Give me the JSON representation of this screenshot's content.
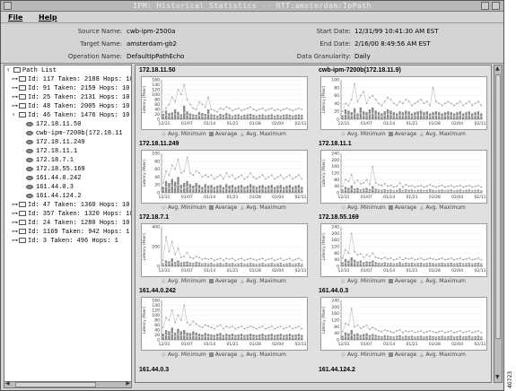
{
  "window": {
    "title": "IPM: Historical Statistics -- RTT:amsterdam:IpPath"
  },
  "menu": {
    "file": "File",
    "help": "Help"
  },
  "info": {
    "source_label": "Source Name:",
    "source_value": "cwb-ipm-2500a",
    "target_label": "Target Name:",
    "target_value": "amsterdam-gb2",
    "operation_label": "Operation Name:",
    "operation_value": "DefaultIpPathEcho",
    "start_label": "Start Date:",
    "start_value": "12/31/99 10:41:30 AM EST",
    "end_label": "End Date:",
    "end_value": "2/16/00 8:49:56 AM EST",
    "gran_label": "Data Granularity:",
    "gran_value": "Daily"
  },
  "tree": {
    "root": "Path List",
    "paths": [
      "Id: 117  Taken: 2188  Hops: 10",
      "Id:  91  Taken: 2159  Hops: 10",
      "Id:  25  Taken: 2131  Hops: 10",
      "Id:  48  Taken: 2005  Hops: 10",
      "Id:  46  Taken: 1476  Hops: 10"
    ],
    "hops": [
      "172.18.11.50",
      "cwb-ipm-7200b(172.18.11",
      "172.18.11.249",
      "172.18.11.1",
      "172.18.7.1",
      "172.18.55.169",
      "161.44.0.242",
      "161.44.0.3",
      "161.44.124.2"
    ],
    "paths_after": [
      "Id:  47  Taken: 1360  Hops: 10",
      "Id: 357  Taken: 1320  Hops: 10",
      "Id:  24  Taken: 1280  Hops: 10",
      "Id: 1169  Taken: 942  Hops: 1",
      "Id:   3  Taken: 496  Hops: 1"
    ]
  },
  "legend": {
    "min": "Avg. Minimum",
    "avg": "Average",
    "max": "Avg. Maximum"
  },
  "ylabel": "Latency (Msec)",
  "xticks": [
    "12/31",
    "01/07",
    "01/14",
    "01/21",
    "01/28",
    "02/04",
    "02/11"
  ],
  "chart_data": [
    {
      "type": "bar",
      "title": "172.18.11.50",
      "yticks": [
        "0",
        "20",
        "40",
        "60",
        "80",
        "100",
        "120",
        "140",
        "160"
      ],
      "ylim": [
        0,
        160
      ],
      "avg": [
        22,
        35,
        25,
        28,
        40,
        30,
        20,
        55,
        32,
        24,
        20,
        18,
        30,
        25,
        22,
        40,
        20,
        18,
        15,
        22,
        18,
        25,
        20,
        15,
        18,
        20,
        15,
        18,
        20,
        22,
        18,
        15,
        18,
        20,
        15,
        18,
        20,
        15,
        18,
        15,
        18,
        20,
        18,
        15,
        18,
        20,
        18
      ],
      "max": [
        30,
        45,
        60,
        90,
        70,
        120,
        100,
        140,
        80,
        60,
        45,
        40,
        70,
        60,
        50,
        90,
        40,
        35,
        30,
        45,
        40,
        50,
        45,
        35,
        40,
        45,
        35,
        40,
        45,
        50,
        40,
        35,
        40,
        45,
        35,
        40,
        45,
        35,
        40,
        35,
        40,
        45,
        40,
        35,
        40,
        45,
        40
      ]
    },
    {
      "type": "bar",
      "title": "cwb-ipm-7200b(172.18.11.9)",
      "yticks": [
        "0",
        "20",
        "40",
        "60",
        "80",
        "100"
      ],
      "ylim": [
        0,
        100
      ],
      "avg": [
        10,
        25,
        22,
        18,
        28,
        15,
        30,
        20,
        18,
        25,
        30,
        22,
        18,
        15,
        20,
        25,
        22,
        18,
        15,
        20,
        18,
        22,
        20,
        15,
        18,
        20,
        22,
        18,
        20,
        15,
        18,
        20,
        18,
        15,
        18,
        20,
        18,
        15,
        18,
        20,
        15,
        18,
        20,
        15,
        18,
        20,
        15
      ],
      "max": [
        20,
        40,
        35,
        50,
        90,
        45,
        60,
        70,
        40,
        55,
        60,
        50,
        40,
        35,
        45,
        55,
        50,
        40,
        35,
        45,
        40,
        50,
        45,
        35,
        40,
        45,
        50,
        40,
        45,
        35,
        80,
        45,
        40,
        35,
        40,
        45,
        40,
        35,
        40,
        45,
        35,
        40,
        45,
        35,
        40,
        45,
        35
      ]
    },
    {
      "type": "bar",
      "title": "172.18.11.249",
      "yticks": [
        "0",
        "20",
        "40",
        "60",
        "80",
        "100"
      ],
      "ylim": [
        0,
        100
      ],
      "avg": [
        15,
        30,
        25,
        35,
        28,
        40,
        20,
        25,
        30,
        22,
        18,
        25,
        20,
        15,
        22,
        18,
        20,
        15,
        18,
        20,
        15,
        22,
        18,
        20,
        15,
        18,
        20,
        15,
        18,
        22,
        18,
        15,
        18,
        20,
        15,
        18,
        20,
        15,
        18,
        20,
        15,
        18,
        20,
        15,
        18,
        20,
        15
      ],
      "max": [
        25,
        55,
        45,
        70,
        60,
        85,
        50,
        55,
        90,
        50,
        45,
        55,
        50,
        40,
        45,
        40,
        45,
        35,
        40,
        45,
        35,
        50,
        40,
        45,
        35,
        40,
        45,
        35,
        40,
        50,
        40,
        35,
        40,
        45,
        35,
        40,
        45,
        35,
        40,
        45,
        35,
        40,
        45,
        35,
        40,
        45,
        35
      ]
    },
    {
      "type": "bar",
      "title": "172.18.11.1",
      "yticks": [
        "0",
        "40",
        "80",
        "120",
        "160",
        "200",
        "240"
      ],
      "ylim": [
        0,
        240
      ],
      "avg": [
        20,
        35,
        30,
        45,
        25,
        30,
        20,
        25,
        30,
        22,
        40,
        25,
        20,
        18,
        22,
        18,
        20,
        15,
        18,
        25,
        15,
        22,
        18,
        20,
        15,
        18,
        20,
        15,
        18,
        22,
        18,
        15,
        18,
        20,
        15,
        18,
        20,
        15,
        18,
        20,
        15,
        18,
        20,
        15,
        18,
        20,
        15
      ],
      "max": [
        40,
        80,
        70,
        110,
        60,
        75,
        55,
        60,
        80,
        50,
        160,
        60,
        50,
        45,
        55,
        40,
        45,
        35,
        40,
        60,
        35,
        50,
        40,
        45,
        35,
        40,
        45,
        35,
        40,
        50,
        40,
        35,
        40,
        45,
        35,
        40,
        45,
        35,
        40,
        45,
        35,
        40,
        45,
        35,
        40,
        45,
        35
      ]
    },
    {
      "type": "bar",
      "title": "172.18.7.1",
      "yticks": [
        "0",
        "200",
        "400"
      ],
      "ylim": [
        0,
        400
      ],
      "avg": [
        30,
        60,
        50,
        80,
        45,
        60,
        40,
        45,
        50,
        40,
        35,
        45,
        40,
        30,
        35,
        30,
        35,
        25,
        30,
        35,
        25,
        35,
        30,
        35,
        25,
        30,
        35,
        25,
        30,
        35,
        30,
        25,
        30,
        35,
        25,
        30,
        35,
        25,
        30,
        35,
        25,
        30,
        35,
        25,
        30,
        35,
        25
      ],
      "max": [
        60,
        300,
        150,
        250,
        120,
        180,
        90,
        100,
        140,
        90,
        80,
        100,
        90,
        70,
        80,
        70,
        80,
        60,
        70,
        80,
        60,
        80,
        70,
        80,
        60,
        70,
        80,
        60,
        70,
        80,
        70,
        60,
        70,
        80,
        60,
        70,
        80,
        60,
        70,
        80,
        60,
        70,
        80,
        60,
        70,
        80,
        60
      ]
    },
    {
      "type": "bar",
      "title": "172.18.55.169",
      "yticks": [
        "0",
        "40",
        "80",
        "120",
        "160",
        "200",
        "240"
      ],
      "ylim": [
        0,
        240
      ],
      "avg": [
        25,
        45,
        35,
        55,
        40,
        30,
        35,
        25,
        30,
        28,
        35,
        25,
        22,
        20,
        25,
        20,
        22,
        18,
        20,
        25,
        18,
        22,
        20,
        22,
        18,
        20,
        22,
        18,
        20,
        22,
        20,
        18,
        20,
        22,
        18,
        20,
        22,
        18,
        20,
        22,
        18,
        20,
        22,
        18,
        20,
        22,
        18
      ],
      "max": [
        50,
        100,
        80,
        200,
        90,
        70,
        75,
        55,
        70,
        60,
        80,
        55,
        50,
        45,
        55,
        45,
        50,
        40,
        45,
        55,
        40,
        50,
        45,
        50,
        40,
        45,
        50,
        40,
        45,
        50,
        45,
        40,
        45,
        50,
        40,
        45,
        50,
        40,
        45,
        50,
        40,
        45,
        50,
        40,
        45,
        50,
        40
      ]
    },
    {
      "type": "bar",
      "title": "161.44.0.242",
      "yticks": [
        "0",
        "20",
        "40",
        "60",
        "80",
        "100",
        "120",
        "140",
        "160"
      ],
      "ylim": [
        0,
        160
      ],
      "avg": [
        25,
        40,
        35,
        50,
        30,
        45,
        35,
        40,
        30,
        28,
        35,
        30,
        25,
        22,
        28,
        25,
        22,
        20,
        25,
        28,
        20,
        25,
        22,
        25,
        20,
        22,
        25,
        20,
        22,
        25,
        22,
        20,
        22,
        25,
        20,
        22,
        25,
        20,
        22,
        25,
        20,
        22,
        25,
        20,
        22,
        25,
        20
      ],
      "max": [
        50,
        90,
        80,
        120,
        70,
        100,
        80,
        140,
        70,
        60,
        75,
        65,
        55,
        50,
        60,
        55,
        50,
        45,
        55,
        60,
        45,
        55,
        50,
        55,
        45,
        50,
        55,
        45,
        50,
        55,
        50,
        45,
        50,
        55,
        45,
        50,
        55,
        45,
        50,
        55,
        45,
        50,
        55,
        45,
        50,
        55,
        45
      ]
    },
    {
      "type": "bar",
      "title": "161.44.0.3",
      "yticks": [
        "0",
        "40",
        "80",
        "120",
        "160",
        "200",
        "240"
      ],
      "ylim": [
        0,
        240
      ],
      "avg": [
        25,
        45,
        40,
        60,
        35,
        40,
        30,
        35,
        40,
        30,
        35,
        30,
        25,
        22,
        28,
        25,
        22,
        20,
        25,
        28,
        20,
        25,
        22,
        25,
        20,
        22,
        25,
        20,
        22,
        25,
        22,
        20,
        22,
        25,
        20,
        22,
        25,
        20,
        22,
        25,
        20,
        22,
        25,
        20,
        22,
        25,
        20
      ],
      "max": [
        50,
        100,
        90,
        190,
        80,
        90,
        70,
        80,
        90,
        65,
        75,
        65,
        55,
        50,
        60,
        55,
        50,
        45,
        55,
        60,
        45,
        55,
        50,
        55,
        45,
        50,
        55,
        45,
        50,
        55,
        50,
        45,
        50,
        55,
        45,
        50,
        55,
        45,
        50,
        55,
        45,
        50,
        55,
        45,
        50,
        55,
        45
      ]
    }
  ],
  "bottom_titles": [
    "161.44.0.3",
    "161.44.124.2"
  ],
  "figure_id": "40723"
}
